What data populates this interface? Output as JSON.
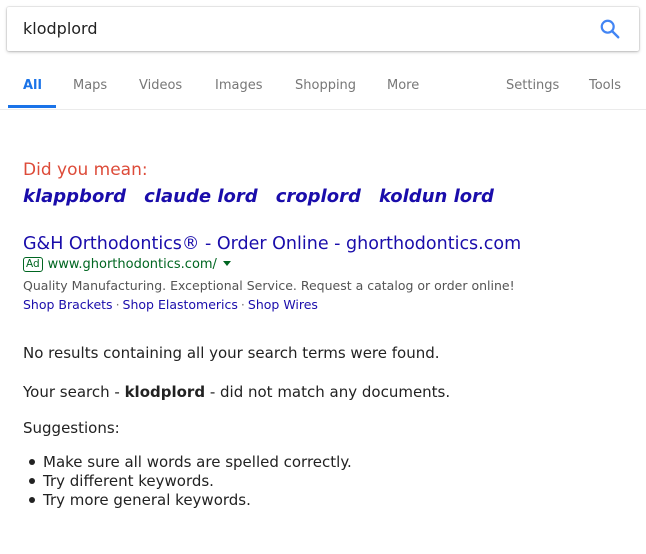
{
  "search": {
    "query": "klodplord"
  },
  "tabs": [
    {
      "label": "All"
    },
    {
      "label": "Maps"
    },
    {
      "label": "Videos"
    },
    {
      "label": "Images"
    },
    {
      "label": "Shopping"
    },
    {
      "label": "More"
    },
    {
      "label": "Settings"
    },
    {
      "label": "Tools"
    }
  ],
  "did_you_mean": {
    "label": "Did you mean:",
    "suggestions": [
      "klappbord",
      "claude lord",
      "croplord",
      "koldun lord"
    ]
  },
  "ad": {
    "title": "G&H Orthodontics® - Order Online - ghorthodontics.com",
    "badge": "Ad",
    "url": "www.ghorthodontics.com/",
    "description": "Quality Manufacturing. Exceptional Service. Request a catalog or order online!",
    "sitelinks": [
      "Shop Brackets",
      "Shop Elastomerics",
      "Shop Wires"
    ],
    "sitelink_separator": "·"
  },
  "results": {
    "no_results": "No results containing all your search terms were found.",
    "your_search_prefix": "Your search - ",
    "your_search_term": "klodplord",
    "your_search_suffix": " - did not match any documents.",
    "suggestions_heading": "Suggestions:",
    "suggestions": [
      "Make sure all words are spelled correctly.",
      "Try different keywords.",
      "Try more general keywords."
    ]
  },
  "colors": {
    "accent": "#1a73e8",
    "link": "#1a0dab",
    "did_you_mean": "#dd4b39",
    "ad_green": "#006621"
  },
  "icons": {
    "search": "search-icon",
    "dropdown": "caret-down-icon",
    "bullet": "bullet-icon"
  }
}
